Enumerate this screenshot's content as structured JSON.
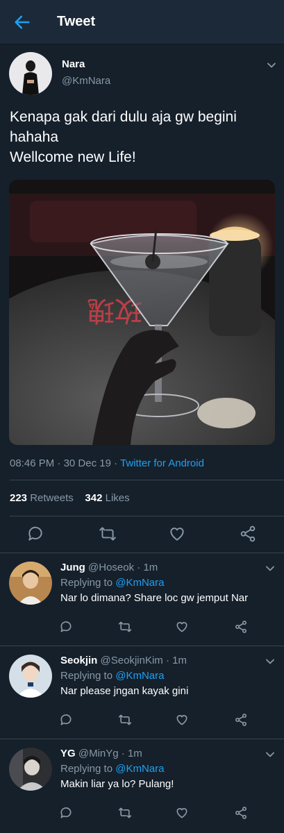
{
  "header": {
    "title": "Tweet"
  },
  "tweet": {
    "author_name": "Nara",
    "author_handle": "@KmNara",
    "text_line1": "Kenapa gak dari dulu aja gw begini",
    "text_line2": "hahaha",
    "text_line3": "Wellcome new Life!",
    "photo_sign_text": "玫瑰",
    "time": "08:46 PM",
    "date": "30 Dec 19",
    "dot": "·",
    "source": "Twitter for Android",
    "retweet_count": "223",
    "retweet_label": "Retweets",
    "like_count": "342",
    "like_label": "Likes"
  },
  "replies": [
    {
      "name": "Jung",
      "handle": "@Hoseok",
      "time": "1m",
      "replying_label": "Replying to",
      "replying_to": "@KmNara",
      "text": "Nar lo dimana? Share loc gw jemput Nar"
    },
    {
      "name": "Seokjin",
      "handle": "@SeokjinKim",
      "time": "1m",
      "replying_label": "Replying to",
      "replying_to": "@KmNara",
      "text": "Nar please jngan kayak gini"
    },
    {
      "name": "YG",
      "handle": "@MinYg",
      "time": "1m",
      "replying_label": "Replying to",
      "replying_to": "@KmNara",
      "text": "Makin liar ya lo? Pulang!"
    }
  ],
  "icons": {
    "back": "arrow-left-icon",
    "menu": "chevron-down-icon",
    "reply": "comment-icon",
    "retweet": "retweet-icon",
    "like": "heart-icon",
    "share": "share-icon"
  },
  "colors": {
    "background": "#15202b",
    "header": "#1c2938",
    "accent": "#1da1f2",
    "secondary_text": "#8899a6",
    "divider": "#38444d"
  }
}
